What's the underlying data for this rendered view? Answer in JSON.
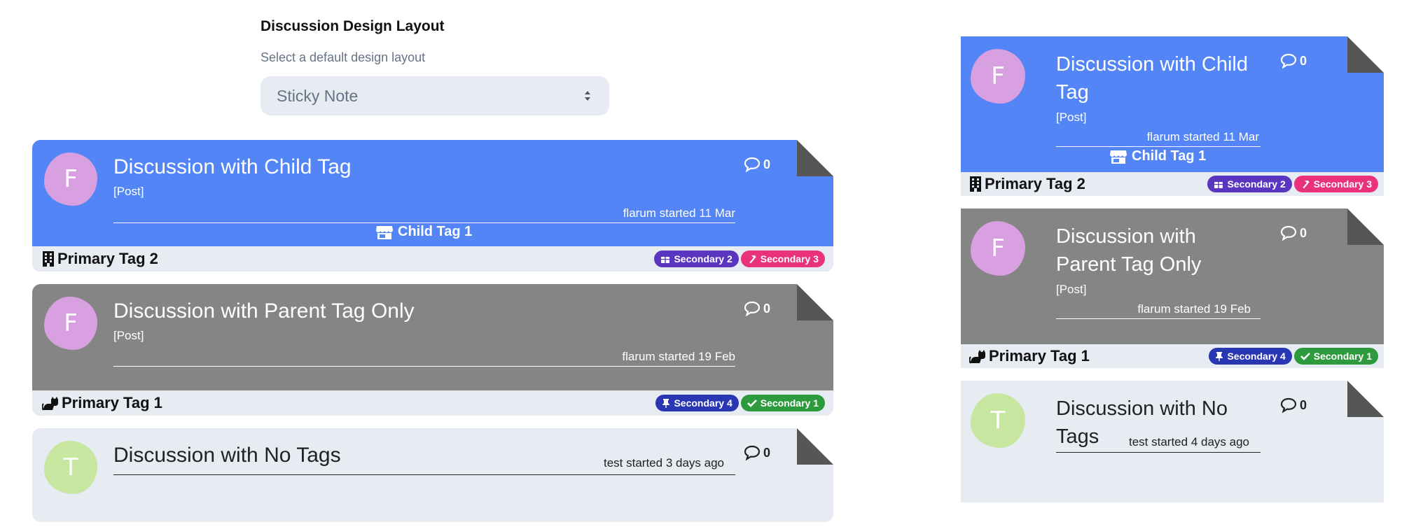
{
  "settings": {
    "label": "Discussion Design Layout",
    "help": "Select a default design layout",
    "selected": "Sticky Note"
  },
  "colors": {
    "blue": "#5385f6",
    "gray": "#858585",
    "light": "#e7ebf2",
    "fold": "#565656",
    "avatar_f": "#d8a0e0",
    "avatar_t": "#c7e6a0",
    "badge_purple": "#5a35c0",
    "badge_pink": "#e9317c",
    "badge_navy": "#2a37b3",
    "badge_green": "#2e9a3e"
  },
  "discussions": [
    {
      "avatar": "F",
      "title": "Discussion with Child Tag",
      "post_label": "[Post]",
      "meta": "flarum started 11 Mar",
      "meta_narrow": "flarum started 11 Mar",
      "replies": "0",
      "child_tag": "Child Tag 1",
      "child_tag_icon": "store-icon",
      "primary_tag": "Primary Tag 2",
      "primary_tag_icon": "building-icon",
      "badges": [
        {
          "label": "Secondary 2",
          "icon": "gift-icon"
        },
        {
          "label": "Secondary 3",
          "icon": "hammer-icon"
        }
      ]
    },
    {
      "avatar": "F",
      "title": "Discussion with Parent Tag Only",
      "post_label": "[Post]",
      "meta": "flarum started 19 Feb",
      "meta_narrow": "flarum started 19 Feb",
      "replies": "0",
      "primary_tag": "Primary Tag 1",
      "primary_tag_icon": "cat-icon",
      "badges": [
        {
          "label": "Secondary 4",
          "icon": "thumbtack-icon"
        },
        {
          "label": "Secondary 1",
          "icon": "check-icon"
        }
      ]
    },
    {
      "avatar": "T",
      "title": "Discussion with No Tags",
      "meta": "test started 3 days ago",
      "meta_narrow": "test started 4 days ago",
      "replies": "0"
    }
  ]
}
